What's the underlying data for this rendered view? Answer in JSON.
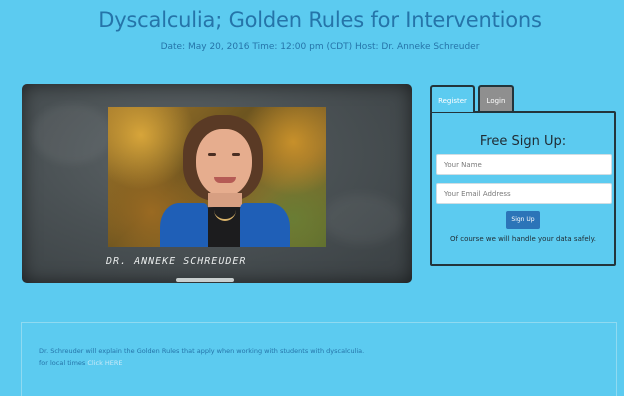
{
  "header": {
    "title": "Dyscalculia; Golden Rules for Interventions",
    "subtitle": "Date: May 20, 2016 Time: 12:00 pm (CDT) Host: Dr. Anneke Schreuder"
  },
  "presenter": {
    "chalk_name": "DR. ANNEKE SCHREUDER"
  },
  "signup": {
    "tabs": [
      {
        "label": "Register",
        "active": true
      },
      {
        "label": "Login",
        "active": false
      }
    ],
    "title": "Free Sign Up:",
    "name_placeholder": "Your Name",
    "email_placeholder": "Your Email Address",
    "button_label": "Sign Up",
    "privacy_note": "Of course we will handle your data safely."
  },
  "description": {
    "line1": "Dr. Schreuder will explain the Golden Rules that apply when working with students with dyscalculia.",
    "line2_prefix": "for local times ",
    "line2_link": "Click HERE"
  },
  "colors": {
    "background": "#5ccbf0",
    "title": "#2574a9",
    "button": "#2c74b8",
    "inactive_tab": "#8f8f8f"
  }
}
